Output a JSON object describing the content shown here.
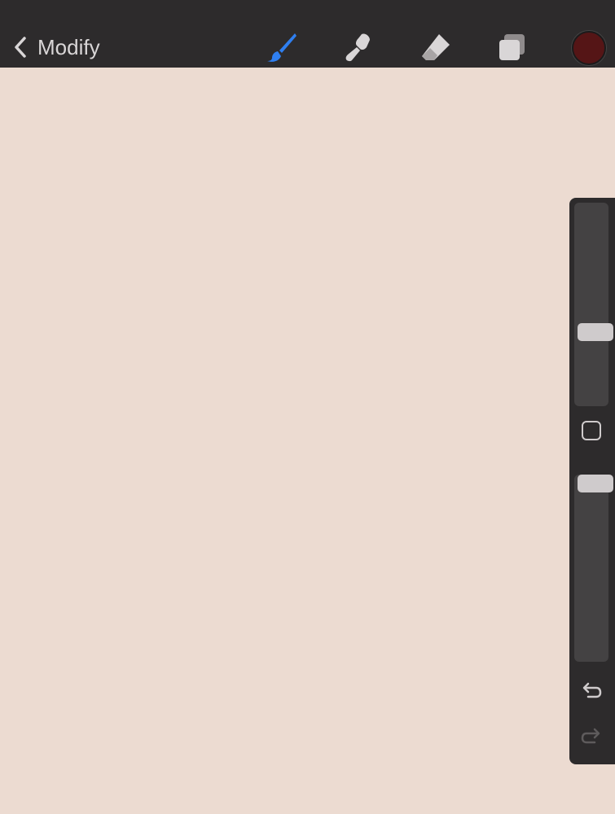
{
  "toolbar": {
    "back_label": "Modify",
    "tools": [
      {
        "name": "brush-icon",
        "active": true
      },
      {
        "name": "smudge-icon",
        "active": false
      },
      {
        "name": "eraser-icon",
        "active": false
      },
      {
        "name": "layers-icon",
        "active": false
      }
    ],
    "current_color": "#551516",
    "active_color": "#2f7ff0",
    "icon_color": "#d9d6d7"
  },
  "canvas": {
    "background": "#ecdbd1"
  },
  "sidebar": {
    "brush_size_level": 0.65,
    "opacity_level": 0.0,
    "undo_icon": "undo-icon",
    "redo_icon": "redo-icon",
    "modify_icon": "square-icon"
  }
}
